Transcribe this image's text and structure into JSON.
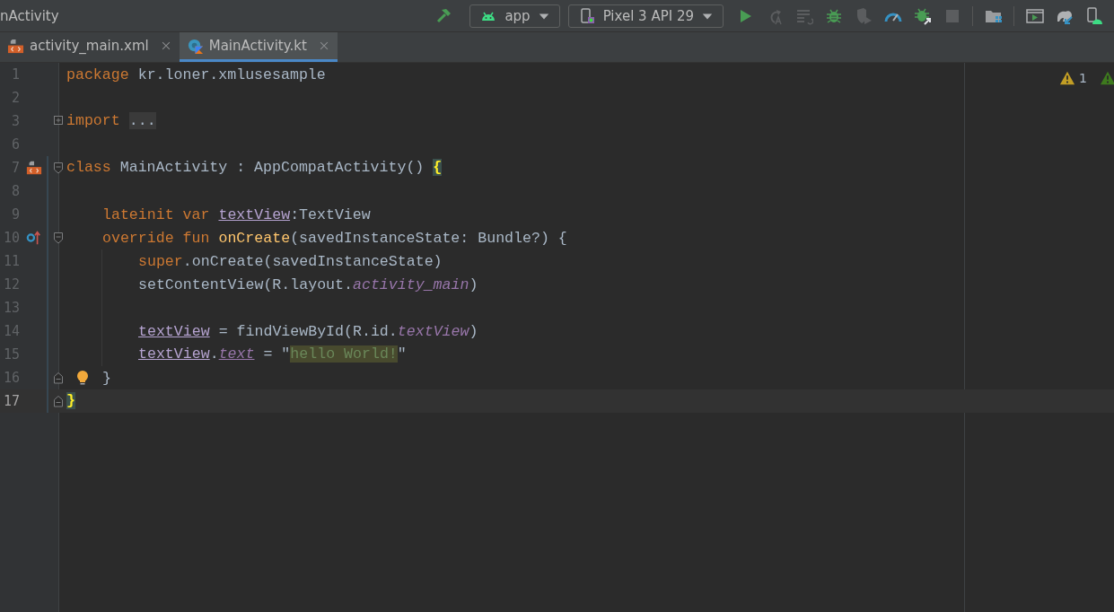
{
  "window": {
    "title": "nActivity"
  },
  "toolbar": {
    "build": {
      "kind": "hammer"
    },
    "config": {
      "label": "app"
    },
    "device": {
      "label": "Pixel 3 API 29"
    },
    "groups": [
      [
        {
          "kind": "run",
          "disabled": false
        },
        {
          "kind": "rerun",
          "disabled": true
        },
        {
          "kind": "apply-code",
          "disabled": true
        },
        {
          "kind": "debug",
          "disabled": false
        },
        {
          "kind": "attach",
          "disabled": true
        },
        {
          "kind": "profile",
          "disabled": false
        },
        {
          "kind": "debug-attach",
          "disabled": false
        },
        {
          "kind": "stop",
          "disabled": true
        }
      ],
      [
        {
          "kind": "files",
          "disabled": false
        }
      ],
      [
        {
          "kind": "run-window",
          "disabled": false
        },
        {
          "kind": "sync",
          "disabled": false
        },
        {
          "kind": "device-manager",
          "disabled": false
        }
      ]
    ]
  },
  "tabs": [
    {
      "label": "activity_main.xml",
      "kind": "layout",
      "selected": false
    },
    {
      "label": "MainActivity.kt",
      "kind": "kotlin",
      "selected": true
    }
  ],
  "editor": {
    "inspections": {
      "warnings": "1"
    },
    "lines": [
      {
        "number": "1",
        "current": false,
        "changed": false,
        "tokens": [
          {
            "text": "package ",
            "kind": "keyword"
          },
          {
            "text": "kr.loner.xmlusesample",
            "kind": "plain"
          }
        ]
      },
      {
        "number": "2",
        "current": false,
        "changed": false
      },
      {
        "number": "3",
        "current": false,
        "changed": false,
        "fold": {
          "kind": "collapsed"
        },
        "tokens": [
          {
            "text": "import ",
            "kind": "keyword"
          },
          {
            "text": "...",
            "kind": "folded"
          }
        ]
      },
      {
        "number": "6",
        "current": false,
        "changed": false
      },
      {
        "number": "7",
        "current": false,
        "changed": true,
        "fold": {
          "kind": "start"
        },
        "marker": {
          "kind": "layout"
        },
        "tokens": [
          {
            "text": "class ",
            "kind": "keyword"
          },
          {
            "text": "MainActivity : AppCompatActivity() ",
            "kind": "plain"
          },
          {
            "text": "{",
            "kind": "brace-match"
          }
        ],
        "children": [
          {
            "number": "8",
            "current": false,
            "changed": true
          },
          {
            "number": "9",
            "current": false,
            "changed": true,
            "tokens": [
              {
                "text": "lateinit var ",
                "kind": "keyword"
              },
              {
                "text": "textView",
                "kind": "var-ref"
              },
              {
                "text": ":TextView",
                "kind": "plain"
              }
            ]
          },
          {
            "number": "10",
            "current": false,
            "changed": true,
            "fold": {
              "kind": "start"
            },
            "marker": {
              "kind": "override"
            },
            "tokens": [
              {
                "text": "override fun ",
                "kind": "keyword"
              },
              {
                "text": "onCreate",
                "kind": "function"
              },
              {
                "text": "(savedInstanceState: Bundle?) {",
                "kind": "plain"
              }
            ],
            "children": [
              {
                "number": "11",
                "current": false,
                "changed": true,
                "tokens": [
                  {
                    "text": "super",
                    "kind": "keyword"
                  },
                  {
                    "text": ".onCreate(savedInstanceState)",
                    "kind": "plain"
                  }
                ]
              },
              {
                "number": "12",
                "current": false,
                "changed": true,
                "tokens": [
                  {
                    "text": "setContentView(R.layout.",
                    "kind": "plain"
                  },
                  {
                    "text": "activity_main",
                    "kind": "field"
                  },
                  {
                    "text": ")",
                    "kind": "plain"
                  }
                ]
              },
              {
                "number": "13",
                "current": false,
                "changed": true
              },
              {
                "number": "14",
                "current": false,
                "changed": true,
                "tokens": [
                  {
                    "text": "textView",
                    "kind": "var-ref"
                  },
                  {
                    "text": " = findViewById(R.id.",
                    "kind": "plain"
                  },
                  {
                    "text": "textView",
                    "kind": "field"
                  },
                  {
                    "text": ")",
                    "kind": "plain"
                  }
                ]
              },
              {
                "number": "15",
                "current": false,
                "changed": true,
                "tokens": [
                  {
                    "text": "textView",
                    "kind": "var-ref"
                  },
                  {
                    "text": ".",
                    "kind": "plain"
                  },
                  {
                    "text": "text",
                    "kind": "field-ref"
                  },
                  {
                    "text": " = \"",
                    "kind": "plain"
                  },
                  {
                    "text": "hello World!",
                    "kind": "string-match"
                  },
                  {
                    "text": "\"",
                    "kind": "plain"
                  }
                ]
              }
            ]
          },
          {
            "number": "16",
            "current": false,
            "changed": true,
            "fold": {
              "kind": "end"
            },
            "intention": true,
            "tokens": [
              {
                "text": "}",
                "kind": "plain"
              }
            ]
          }
        ]
      },
      {
        "number": "17",
        "current": true,
        "changed": true,
        "fold": {
          "kind": "end"
        },
        "tokens": [
          {
            "text": "}",
            "kind": "brace-match"
          }
        ]
      }
    ]
  }
}
